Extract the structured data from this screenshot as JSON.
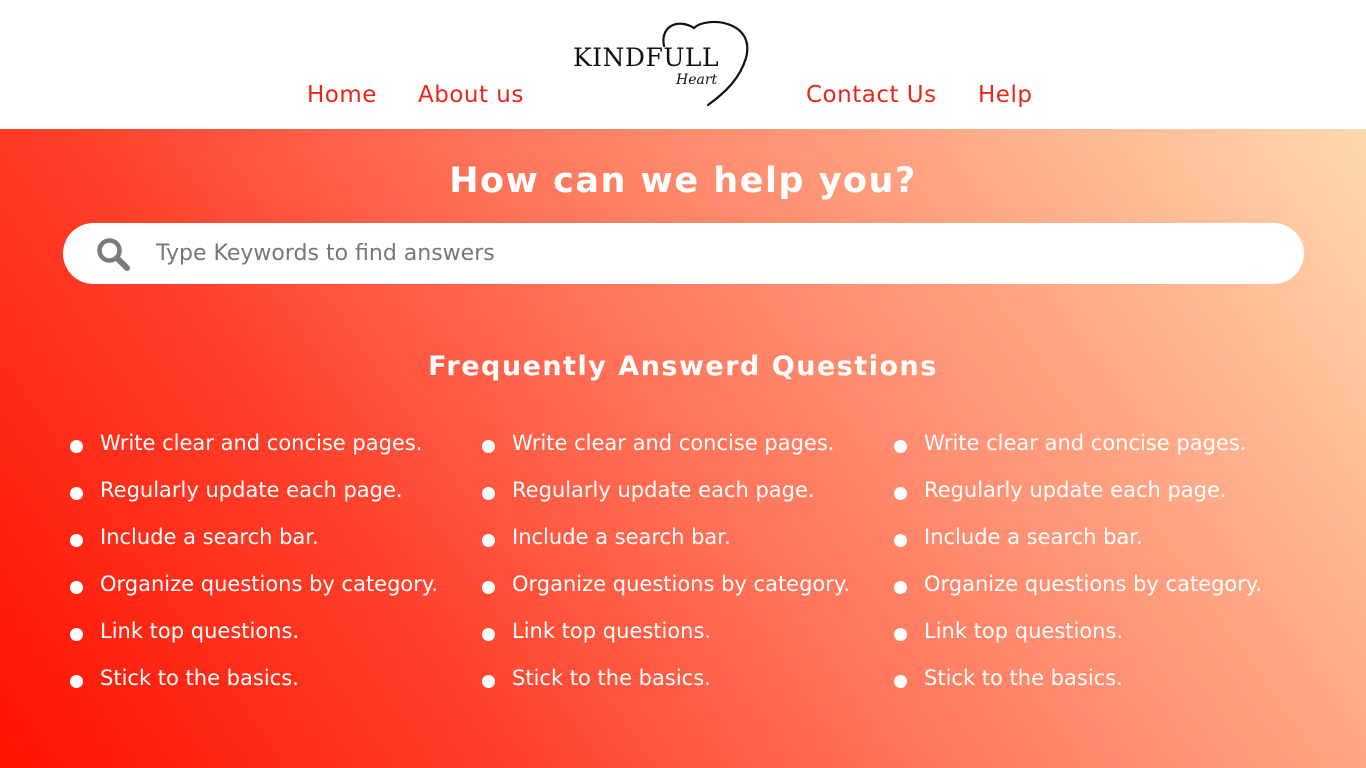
{
  "header": {
    "nav": {
      "home": "Home",
      "about": "About us",
      "contact": "Contact Us",
      "help": "Help"
    },
    "logo": {
      "name": "KINDFULL",
      "sub": "Heart",
      "icon": "heart-icon"
    }
  },
  "hero": {
    "title": "How can we help you?",
    "search": {
      "placeholder": "Type Keywords to find answers",
      "icon": "search-icon"
    },
    "faq_title": "Frequently Answerd Questions",
    "faq_columns": [
      [
        "Write clear and concise pages.",
        "Regularly update each page.",
        "Include a search bar.",
        "Organize questions by category.",
        "Link top questions.",
        "Stick to the basics."
      ],
      [
        "Write clear and concise pages.",
        "Regularly update each page.",
        "Include a search bar.",
        "Organize questions by category.",
        "Link top questions.",
        "Stick to the basics."
      ],
      [
        "Write clear and concise pages.",
        "Regularly update each page.",
        "Include a search bar.",
        "Organize questions by category.",
        "Link top questions.",
        "Stick to the basics."
      ]
    ]
  },
  "colors": {
    "accent": "#e8271b",
    "gradient_start": "#ff1200",
    "gradient_end": "#ffd9ae",
    "text_on_hero": "#ffffff"
  }
}
